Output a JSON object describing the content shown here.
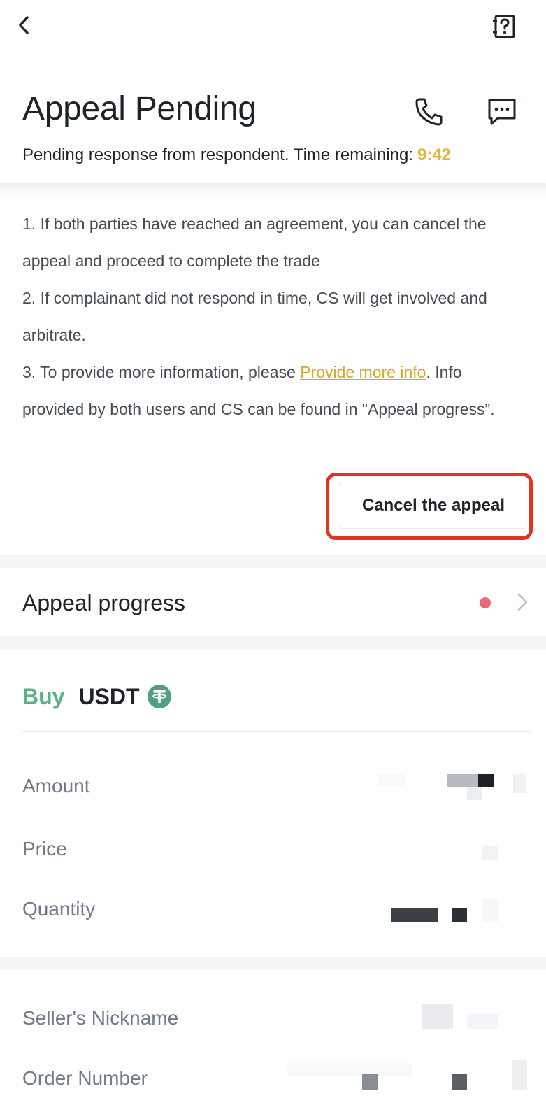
{
  "header": {
    "back_icon": "chevron-left-icon",
    "help_icon": "question-book-icon",
    "title": "Appeal Pending",
    "phone_icon": "phone-icon",
    "chat_icon": "chat-bubble-icon",
    "subtitle": "Pending response from respondent. Time remaining:",
    "timer": "9:42",
    "timer_color": "#e0b33a"
  },
  "notes": {
    "item1": "1. If both parties have reached an agreement, you can cancel the appeal and proceed to complete the trade",
    "item2": "2. If complainant did not respond in time, CS will get involved and arbitrate.",
    "item3_pre": "3. To provide more information, please ",
    "item3_link": "Provide more info",
    "item3_post": ". Info provided by both users and CS can be found in \"Appeal progress”."
  },
  "cancel_button": {
    "label": "Cancel the appeal",
    "highlight_color": "#e0361f"
  },
  "appeal_progress": {
    "label": "Appeal progress",
    "dot_color": "#e76a78",
    "chevron_icon": "chevron-right-icon"
  },
  "order": {
    "side": "Buy",
    "side_color": "#58b187",
    "asset": "USDT",
    "asset_icon": "tether-icon",
    "rows": [
      {
        "label": "Amount"
      },
      {
        "label": "Price"
      },
      {
        "label": "Quantity"
      }
    ]
  },
  "counterparty": {
    "rows": [
      {
        "label": "Seller's Nickname"
      },
      {
        "label": "Order Number"
      }
    ]
  }
}
